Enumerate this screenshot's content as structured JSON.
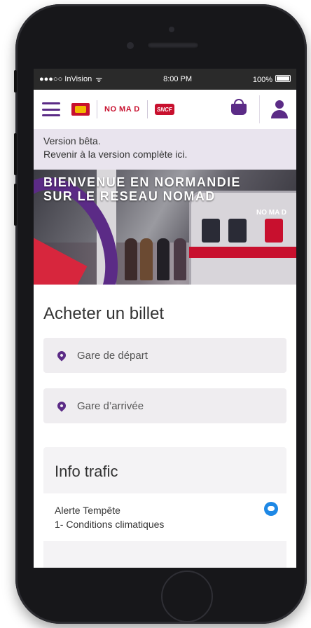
{
  "status_bar": {
    "carrier": "●●●○○ InVision",
    "wifi_icon": "wifi-icon",
    "time": "8:00 PM",
    "battery": "100%"
  },
  "header": {
    "logo_nomad": "NO MA D",
    "logo_sncf": "SNCF",
    "region_label": "NORMANDIE"
  },
  "beta_banner": {
    "line1": "Version bêta.",
    "line2": "Revenir à la version complète ici."
  },
  "hero": {
    "title_line1": "BIENVENUE EN NORMANDIE",
    "title_line2": "SUR LE RESEAU NOMAD",
    "train_brand": "NO MA D"
  },
  "buy_ticket": {
    "title": "Acheter un billet",
    "departure_placeholder": "Gare de départ",
    "arrival_placeholder": "Gare d’arrivée"
  },
  "traffic": {
    "title": "Info trafic",
    "alert_title": "Alerte Tempête",
    "alert_line1": "1- Conditions climatiques"
  },
  "colors": {
    "brand_purple": "#5b2b86",
    "brand_red": "#c8102e",
    "info_blue": "#1e88e5"
  }
}
